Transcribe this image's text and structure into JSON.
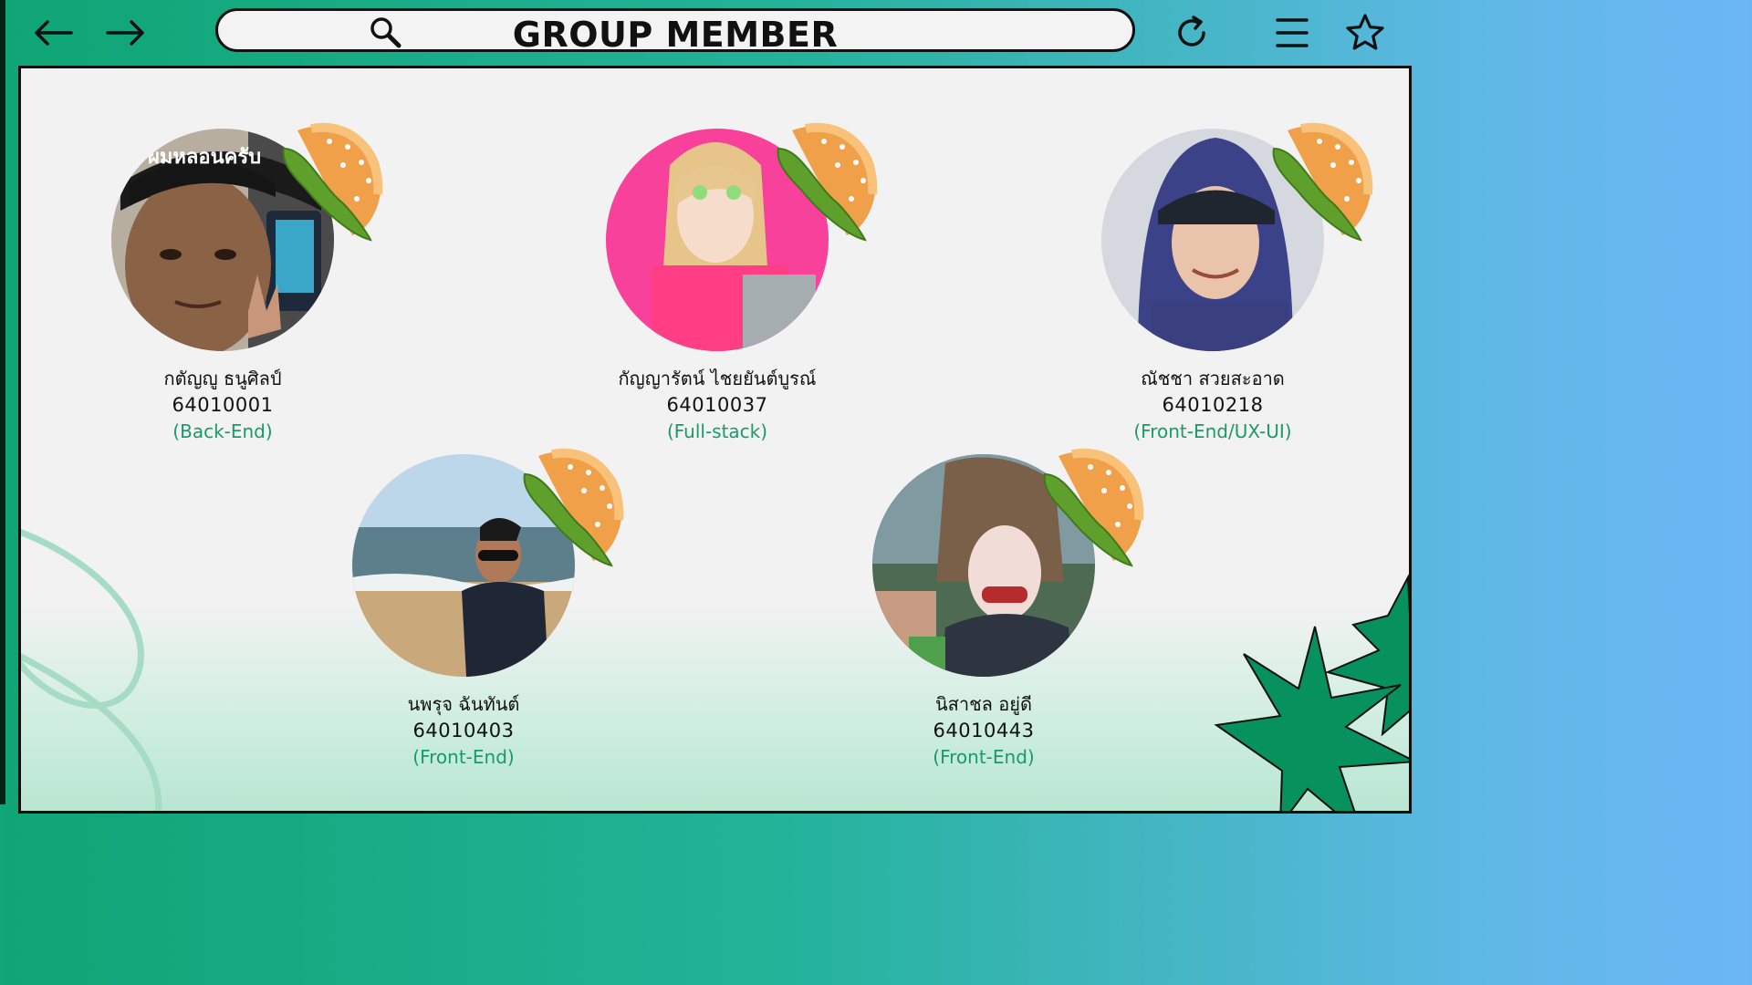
{
  "header": {
    "title": "GROUP MEMBER",
    "icons": [
      "arrow-left-icon",
      "arrow-right-icon",
      "search-icon",
      "refresh-icon",
      "menu-icon",
      "star-icon"
    ]
  },
  "members": [
    {
      "name": "กตัญญู ธนูศิลป์",
      "id": "64010001",
      "role": "(Back-End)",
      "photo_caption": "ผมหลอนครับ",
      "bg": "#8a6a55"
    },
    {
      "name": "กัญญารัตน์ ไชยยันต์บูรณ์",
      "id": "64010037",
      "role": "(Full-stack)",
      "bg": "#f7419a"
    },
    {
      "name": "ณัชชา สวยสะอาด",
      "id": "64010218",
      "role": "(Front-End/UX-UI)",
      "bg": "#c9ccd8"
    },
    {
      "name": "นพรุจ ฉันทันต์",
      "id": "64010403",
      "role": "(Front-End)",
      "bg": "#a9c6dc"
    },
    {
      "name": "นิสาชล อยู่ดี",
      "id": "64010443",
      "role": "(Front-End)",
      "bg": "#5c6a55"
    }
  ],
  "colors": {
    "accent": "#1a9a6a",
    "star": "#07915d",
    "bar_start": "#0fa574",
    "bar_end": "#6cb6f5"
  }
}
